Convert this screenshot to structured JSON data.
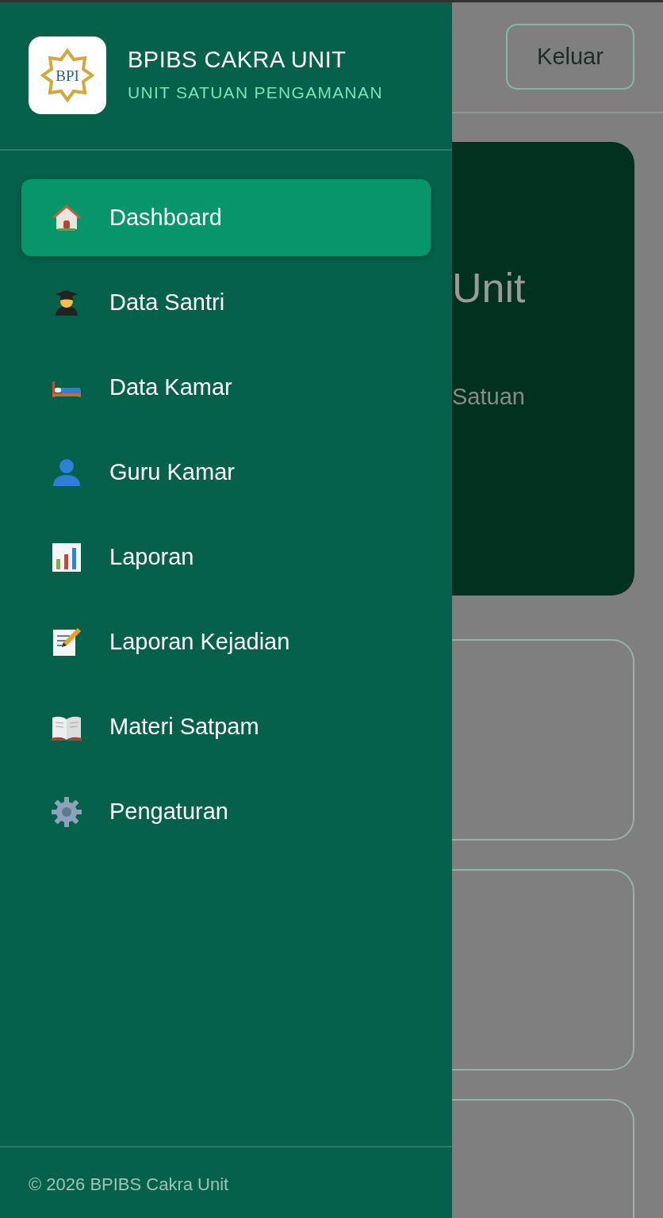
{
  "drawer": {
    "logo_text": "BPI",
    "title": "BPIBS CAKRA UNIT",
    "subtitle": "UNIT SATUAN PENGAMANAN",
    "items": [
      {
        "label": "Dashboard",
        "selected": true
      },
      {
        "label": "Data Santri",
        "selected": false
      },
      {
        "label": "Data Kamar",
        "selected": false
      },
      {
        "label": "Guru Kamar",
        "selected": false
      },
      {
        "label": "Laporan",
        "selected": false
      },
      {
        "label": "Laporan Kejadian",
        "selected": false
      },
      {
        "label": "Materi Satpam",
        "selected": false
      },
      {
        "label": "Pengaturan",
        "selected": false
      }
    ],
    "footer": "© 2026 BPIBS Cakra Unit"
  },
  "page": {
    "logout_button": "Keluar",
    "hero": {
      "title": "Unit",
      "subtitle": "Satuan"
    }
  }
}
